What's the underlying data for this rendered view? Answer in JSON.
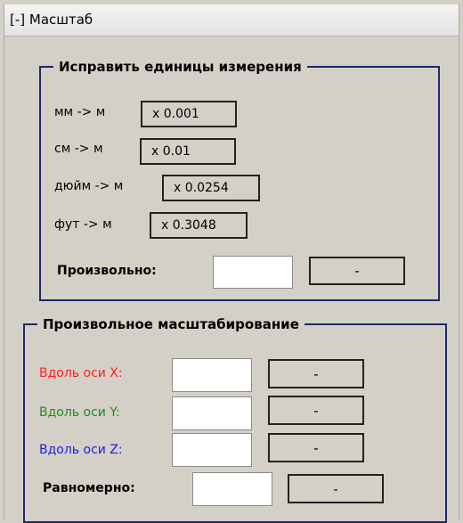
{
  "panel": {
    "title": "[-] Масштаб"
  },
  "fix_units": {
    "legend": "Исправить единицы измерения",
    "rows": [
      {
        "label": "мм -> м",
        "factor": "x 0.001"
      },
      {
        "label": "см -> м",
        "factor": "x 0.01"
      },
      {
        "label": "дюйм -> м",
        "factor": "x 0.0254"
      },
      {
        "label": "фут -> м",
        "factor": "x 0.3048"
      }
    ],
    "custom_label": "Произвольно:",
    "custom_value": "",
    "custom_button": "-"
  },
  "custom_scaling": {
    "legend": "Произвольное масштабирование",
    "axes": [
      {
        "label": "Вдоль оси X:",
        "value": "",
        "button": "-",
        "color": "#ff1e1e"
      },
      {
        "label": "Вдоль оси Y:",
        "value": "",
        "button": "-",
        "color": "#1f8a1f"
      },
      {
        "label": "Вдоль оси Z:",
        "value": "",
        "button": "-",
        "color": "#1e1ee0"
      }
    ],
    "uniform_label": "Равномерно:",
    "uniform_value": "",
    "uniform_button": "-"
  }
}
